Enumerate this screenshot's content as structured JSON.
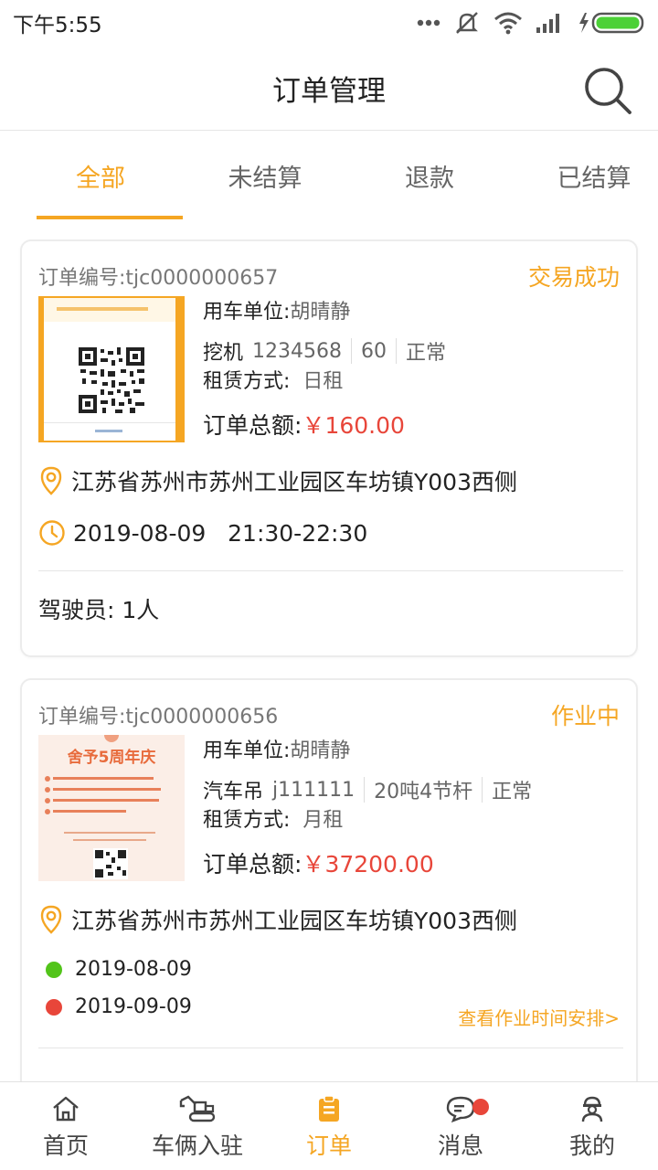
{
  "status_bar": {
    "time": "下午5:55"
  },
  "header": {
    "title": "订单管理"
  },
  "tabs": [
    {
      "label": "全部",
      "active": true
    },
    {
      "label": "未结算",
      "active": false
    },
    {
      "label": "退款",
      "active": false
    },
    {
      "label": "已结算",
      "active": false
    }
  ],
  "orders": [
    {
      "order_no": "订单编号:tjc0000000657",
      "status": "交易成功",
      "company_label": "用车单位:",
      "company": "胡晴静",
      "vehicle_type": "挖机",
      "plate": "1234568",
      "spec": "60",
      "condition": "正常",
      "rent_label": "租赁方式:",
      "rent_mode": "日租",
      "total_label": "订单总额:",
      "total": "￥160.00",
      "address": "江苏省苏州市苏州工业园区车坊镇Y003西侧",
      "datetime": "2019-08-09   21:30-22:30",
      "drivers": "驾驶员:  1人"
    },
    {
      "order_no": "订单编号:tjc0000000656",
      "status": "作业中",
      "company_label": "用车单位:",
      "company": "胡晴静",
      "vehicle_type": "汽车吊",
      "plate": "j111111",
      "spec": "20吨4节杆",
      "condition": "正常",
      "rent_label": "租赁方式:",
      "rent_mode": "月租",
      "total_label": "订单总额:",
      "total": "￥37200.00",
      "address": "江苏省苏州市苏州工业园区车坊镇Y003西侧",
      "start_date": "2019-08-09",
      "end_date": "2019-09-09",
      "schedule_link": "查看作业时间安排>",
      "thumb_title": "舍予5周年庆"
    }
  ],
  "bottom_nav": [
    {
      "label": "首页",
      "icon": "home-icon"
    },
    {
      "label": "车俩入驻",
      "icon": "excavator-icon"
    },
    {
      "label": "订单",
      "icon": "clipboard-icon",
      "active": true
    },
    {
      "label": "消息",
      "icon": "chat-icon",
      "badge": true
    },
    {
      "label": "我的",
      "icon": "worker-icon"
    }
  ],
  "colors": {
    "accent": "#f5a623",
    "price": "#e8463a",
    "start_dot": "#52c41a",
    "end_dot": "#e8463a"
  }
}
